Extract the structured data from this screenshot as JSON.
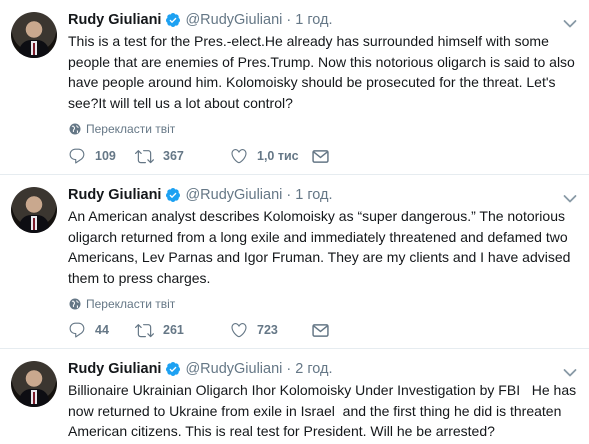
{
  "tweets": [
    {
      "name": "Rudy Giuliani",
      "handle": "@RudyGiuliani",
      "separator": "·",
      "time": "1 год.",
      "text": "This is a test for the Pres.-elect.He already has surrounded himself with some people that are enemies of Pres.Trump. Now this notorious oligarch is said to also have people around him. Kolomoisky should be prosecuted for the threat. Let's see?It will tell us a lot about control?",
      "translate": "Перекласти твіт",
      "replies": "109",
      "retweets": "367",
      "likes": "1,0 тис"
    },
    {
      "name": "Rudy Giuliani",
      "handle": "@RudyGiuliani",
      "separator": "·",
      "time": "1 год.",
      "text": "An American analyst describes Kolomoisky as “super dangerous.” The notorious oligarch returned from a long exile and immediately threatened and defamed two Americans, Lev Parnas and Igor Fruman. They are my clients and I have advised them to press charges.",
      "translate": "Перекласти твіт",
      "replies": "44",
      "retweets": "261",
      "likes": "723"
    },
    {
      "name": "Rudy Giuliani",
      "handle": "@RudyGiuliani",
      "separator": "·",
      "time": "2 год.",
      "text": "Billionaire Ukrainian Oligarch Ihor Kolomoisky Under Investigation by FBI   He has now returned to Ukraine from exile in Israel  and the first thing he did is threaten American citizens. This is real test for President. Will he be arrested?"
    }
  ],
  "colors": {
    "accent": "#1da1f2",
    "muted": "#657786",
    "text": "#14171a",
    "divider": "#e6ecf0"
  },
  "icons": [
    "verified-badge-icon",
    "caret-down-icon",
    "globe-icon",
    "reply-icon",
    "retweet-icon",
    "like-icon",
    "message-icon"
  ]
}
